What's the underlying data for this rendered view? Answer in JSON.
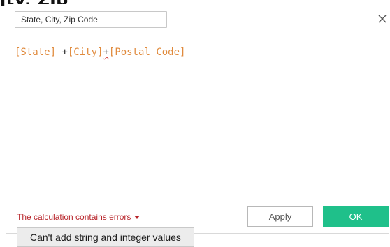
{
  "header": {
    "cutoff_title": "ity, Zip"
  },
  "dialog": {
    "name_field": {
      "value": "State, City, Zip Code"
    },
    "close_icon": "close-icon",
    "formula": {
      "tokens": [
        {
          "text": "[State]",
          "kind": "field"
        },
        {
          "text": " +",
          "kind": "op"
        },
        {
          "text": "[City]",
          "kind": "field"
        },
        {
          "text": "+",
          "kind": "op-error"
        },
        {
          "text": "[Postal Code]",
          "kind": "field"
        }
      ]
    },
    "error_toggle_label": "The calculation contains errors",
    "apply_label": "Apply",
    "ok_label": "OK",
    "error_tooltip": "Can't add string and integer values"
  },
  "colors": {
    "field": "#e08a3c",
    "error": "#b8252b",
    "ok_button": "#1fc08a"
  }
}
